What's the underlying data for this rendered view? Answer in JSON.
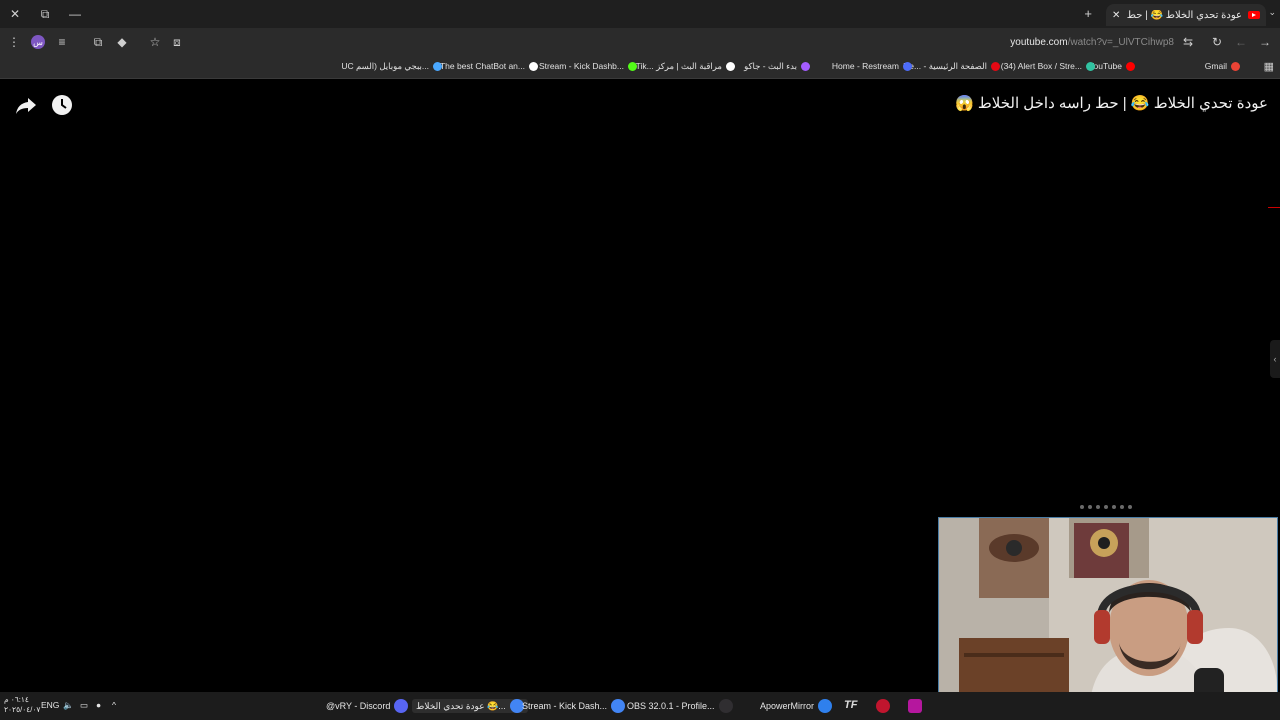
{
  "tab": {
    "title": "عودة تحدي الخلاط 😂 | حط راسه",
    "close": "✕",
    "new_tab": "+"
  },
  "window": {
    "close": "✕",
    "restore": "⧉",
    "minimize": "—"
  },
  "toolbar": {
    "url_host": "youtube.com",
    "url_path": "/watch?v=_UlVTCihwp8",
    "profile_badge": "س"
  },
  "bookmarks": [
    {
      "label": "Gmail",
      "color": "#ea4335"
    },
    {
      "label": "YouTube",
      "color": "#ff0000"
    },
    {
      "label": "(34) Alert Box / Stre...",
      "color": "#31c3a2"
    },
    {
      "label": "Ne... - الصفحة الرئيسية",
      "color": "#e50914"
    },
    {
      "label": "Home - Restream",
      "color": "#4d6cfa"
    },
    {
      "label": "بدء البث - جاكو",
      "color": "#a45cff"
    },
    {
      "label": "Tik... مراقبة البث | مركز",
      "color": "#ffffff"
    },
    {
      "label": "Stream - Kick Dashb...",
      "color": "#53fc18"
    },
    {
      "label": "The best ChatBot an...",
      "color": "#ffffff"
    },
    {
      "label": "UC ببجي موبايل (السم...",
      "color": "#4aa8ff"
    }
  ],
  "video": {
    "title": "عودة تحدي الخلاط 😂 | حط راسه داخل الخلاط 😱"
  },
  "taskbar": {
    "items": [
      {
        "label": "@vRY - Discord",
        "color": "#5865f2",
        "active": false
      },
      {
        "label": "عودة تحدي الخلاط 😂...",
        "color": "#4285f4",
        "active": true
      },
      {
        "label": "Stream - Kick Dash...",
        "color": "#4285f4",
        "active": false
      },
      {
        "label": "OBS 32.0.1 - Profile...",
        "color": "#302e31",
        "active": false
      },
      {
        "label": "ApowerMirror",
        "color": "#2f80ed",
        "active": false
      }
    ],
    "lang": "ENG",
    "time": "٠٦:١٤ م",
    "date": "٢٠٢٥/٠٤/٠٧"
  }
}
